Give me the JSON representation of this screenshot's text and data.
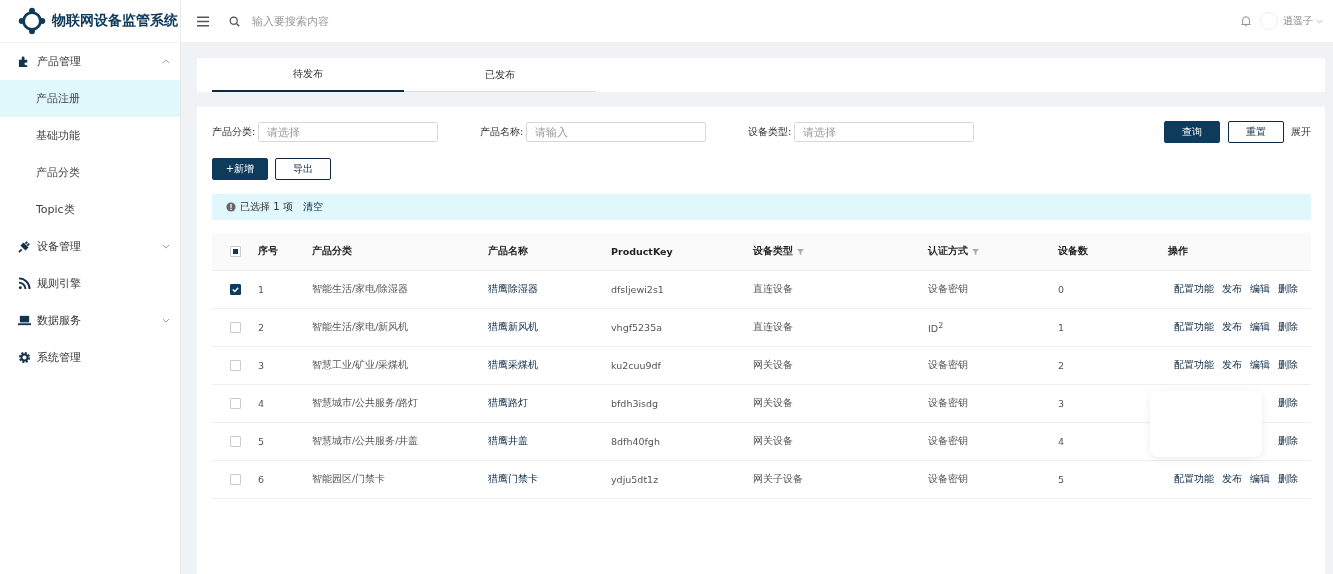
{
  "app": {
    "title": "物联网设备监管系统"
  },
  "header": {
    "search_placeholder": "输入要搜索内容",
    "user": "逍遥子"
  },
  "sidebar": {
    "items": [
      {
        "label": "产品管理",
        "expandable": true,
        "expanded": true,
        "children": [
          {
            "label": "产品注册",
            "selected": true
          },
          {
            "label": "基础功能",
            "selected": false
          },
          {
            "label": "产品分类",
            "selected": false
          },
          {
            "label": "Topic类",
            "selected": false
          }
        ]
      },
      {
        "label": "设备管理",
        "expandable": true,
        "expanded": false
      },
      {
        "label": "规则引擎",
        "expandable": false
      },
      {
        "label": "数据服务",
        "expandable": true,
        "expanded": false
      },
      {
        "label": "系统管理",
        "expandable": false
      }
    ]
  },
  "tabs": [
    {
      "label": "待发布",
      "selected": true
    },
    {
      "label": "已发布",
      "selected": false
    }
  ],
  "filters": [
    {
      "label": "产品分类:",
      "placeholder": "请选择"
    },
    {
      "label": "产品名称:",
      "placeholder": "请输入"
    },
    {
      "label": "设备类型:",
      "placeholder": "请选择"
    }
  ],
  "filter_buttons": {
    "query": "查询",
    "reset": "重置",
    "expand": "展开"
  },
  "actions": {
    "add": "+新增",
    "export": "导出"
  },
  "selection_alert": {
    "text": "已选择 1 项",
    "clear": "清空"
  },
  "table": {
    "select_all_indeterminate": true,
    "columns": [
      {
        "label": "序号",
        "filterable": false
      },
      {
        "label": "产品分类",
        "filterable": false
      },
      {
        "label": "产品名称",
        "filterable": false
      },
      {
        "label": "ProductKey",
        "filterable": false
      },
      {
        "label": "设备类型",
        "filterable": true
      },
      {
        "label": "认证方式",
        "filterable": true
      },
      {
        "label": "设备数",
        "filterable": false
      },
      {
        "label": "操作",
        "filterable": false
      }
    ],
    "rows": [
      {
        "selected": true,
        "cells": [
          "1",
          "智能生活/家电/除湿器",
          "猎鹰除湿器",
          "dfsljewi2s1",
          "直连设备",
          "设备密钥",
          "0"
        ],
        "actions": [
          "配置功能",
          "发布",
          "编辑",
          "删除"
        ]
      },
      {
        "selected": false,
        "cells": [
          "2",
          "智能生活/家电/新风机",
          "猎鹰新风机",
          "vhgf5235a",
          "直连设备",
          "ID$^{2}$",
          "1"
        ],
        "actions": [
          "配置功能",
          "发布",
          "编辑",
          "删除"
        ]
      },
      {
        "selected": false,
        "cells": [
          "3",
          "智慧工业/矿业/采煤机",
          "猎鹰采煤机",
          "ku2cuu9df",
          "网关设备",
          "设备密钥",
          "2"
        ],
        "actions": [
          "配置功能",
          "发布",
          "编辑",
          "删除"
        ]
      },
      {
        "selected": false,
        "cells": [
          "4",
          "智慧城市/公共服务/路灯",
          "猎鹰路灯",
          "bfdh3isdg",
          "网关设备",
          "设备密钥",
          "3"
        ],
        "actions": [
          "删除"
        ]
      },
      {
        "selected": false,
        "cells": [
          "5",
          "智慧城市/公共服务/井盖",
          "猎鹰井盖",
          "8dfh40fgh",
          "网关设备",
          "设备密钥",
          "4"
        ],
        "actions": [
          "删除"
        ]
      },
      {
        "selected": false,
        "cells": [
          "6",
          "智能园区/门禁卡",
          "猎鹰门禁卡",
          "ydju5dt1z",
          "网关子设备",
          "设备密钥",
          "5"
        ],
        "actions": [
          "配置功能",
          "发布",
          "编辑",
          "删除"
        ]
      }
    ]
  },
  "popup": {
    "kind": "blank-card"
  }
}
